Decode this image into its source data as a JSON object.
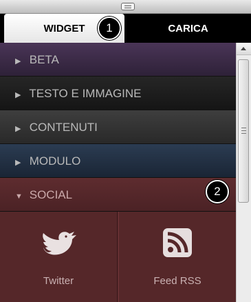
{
  "tabs": {
    "widget_label": "WIDGET",
    "carica_label": "CARICA"
  },
  "callouts": {
    "first": "1",
    "second": "2"
  },
  "accordion": {
    "items": [
      {
        "label": "BETA",
        "arrow": "▶"
      },
      {
        "label": "TESTO E IMMAGINE",
        "arrow": "▶"
      },
      {
        "label": "CONTENUTI",
        "arrow": "▶"
      },
      {
        "label": "MODULO",
        "arrow": "▶"
      },
      {
        "label": "SOCIAL",
        "arrow": "▼",
        "expanded": true
      }
    ]
  },
  "social": {
    "widgets": [
      {
        "label": "Twitter",
        "icon": "twitter-bird-icon"
      },
      {
        "label": "Feed RSS",
        "icon": "rss-icon"
      }
    ]
  },
  "colors": {
    "beta": "#4a3557",
    "testo": "#1f1f1f",
    "contenuti": "#363636",
    "modulo": "#243347",
    "social": "#552729"
  }
}
